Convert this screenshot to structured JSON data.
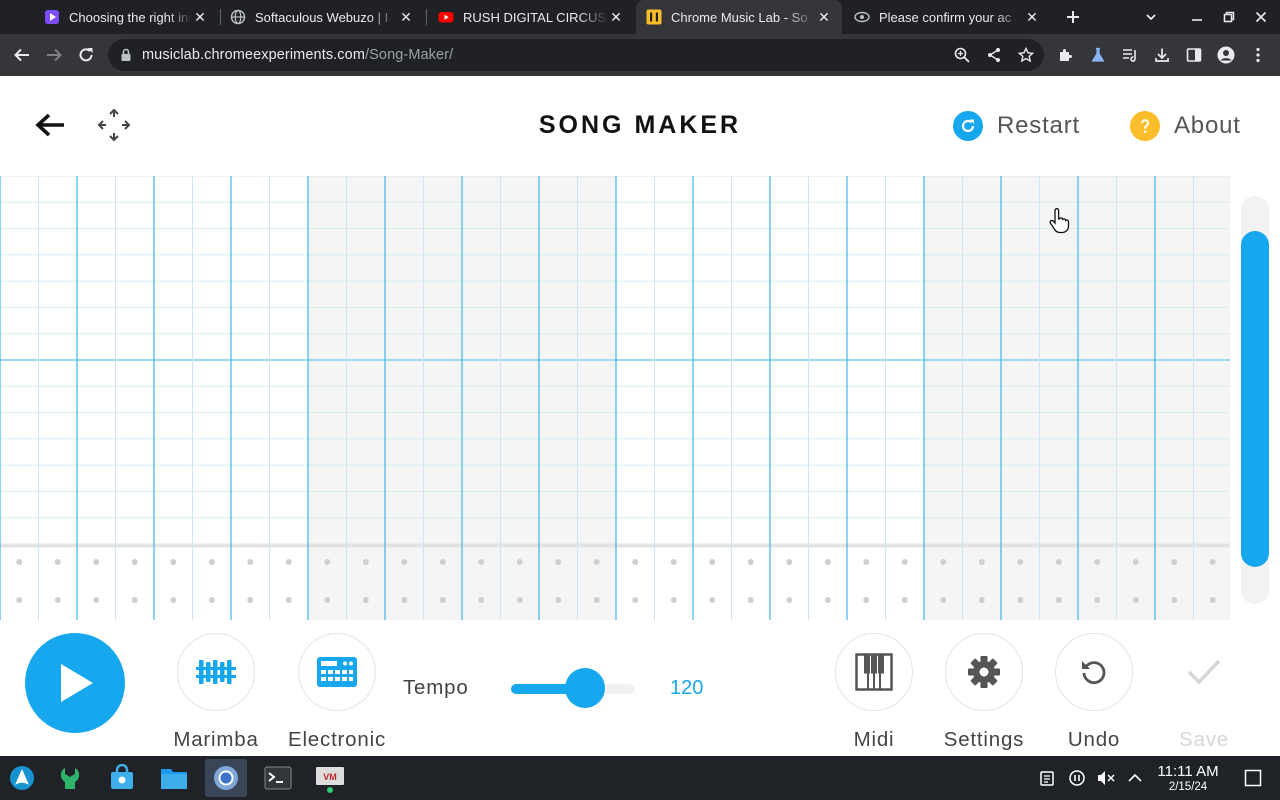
{
  "browser": {
    "tabs": [
      {
        "title": "Choosing the right inst",
        "favicon": "tutorial-play-icon",
        "active": false
      },
      {
        "title": "Softaculous Webuzo | I",
        "favicon": "globe-icon",
        "active": false
      },
      {
        "title": "RUSH DIGITAL CIRCUS",
        "favicon": "youtube-icon",
        "active": false
      },
      {
        "title": "Chrome Music Lab - So",
        "favicon": "music-lab-icon",
        "active": true
      },
      {
        "title": "Please confirm your ac",
        "favicon": "eye-mail-icon",
        "active": false
      }
    ],
    "url_host": "musiclab.chromeexperiments.com",
    "url_path": "/Song-Maker/"
  },
  "app": {
    "title": "SONG MAKER",
    "restart_label": "Restart",
    "about_label": "About",
    "accent_color": "#16a7ee",
    "about_color": "#fbbd2a"
  },
  "controls": {
    "instrument_label": "Marimba",
    "percussion_label": "Electronic",
    "tempo_label": "Tempo",
    "tempo_value": "120",
    "tempo_fraction": 0.6,
    "midi_label": "Midi",
    "settings_label": "Settings",
    "undo_label": "Undo",
    "save_label": "Save"
  },
  "taskbar": {
    "apps": [
      "arch-icon",
      "settings-wrench-icon",
      "store-icon",
      "files-icon",
      "chrome-icon",
      "terminal-icon",
      "vm-icon"
    ],
    "time": "11:11 AM",
    "date": "2/15/24"
  }
}
